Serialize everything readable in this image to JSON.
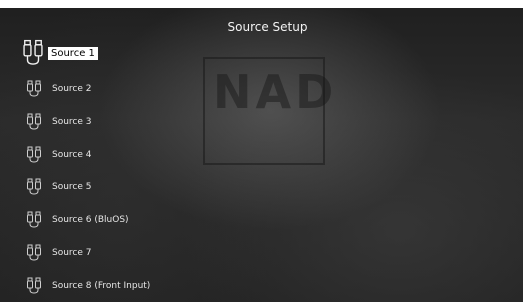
{
  "header": {
    "title": "Source Setup"
  },
  "watermark": {
    "text": "NAD"
  },
  "sources": [
    {
      "label": "Source 1",
      "selected": true
    },
    {
      "label": "Source 2",
      "selected": false
    },
    {
      "label": "Source 3",
      "selected": false
    },
    {
      "label": "Source 4",
      "selected": false
    },
    {
      "label": "Source 5",
      "selected": false
    },
    {
      "label": "Source 6 (BluOS)",
      "selected": false
    },
    {
      "label": "Source 7",
      "selected": false
    },
    {
      "label": "Source 8 (Front Input)",
      "selected": false
    }
  ],
  "icons": {
    "source": "rca-connector-icon"
  },
  "colors": {
    "selected_background": "#ffffff",
    "selected_text": "#000000",
    "text": "#e6e6e6"
  }
}
